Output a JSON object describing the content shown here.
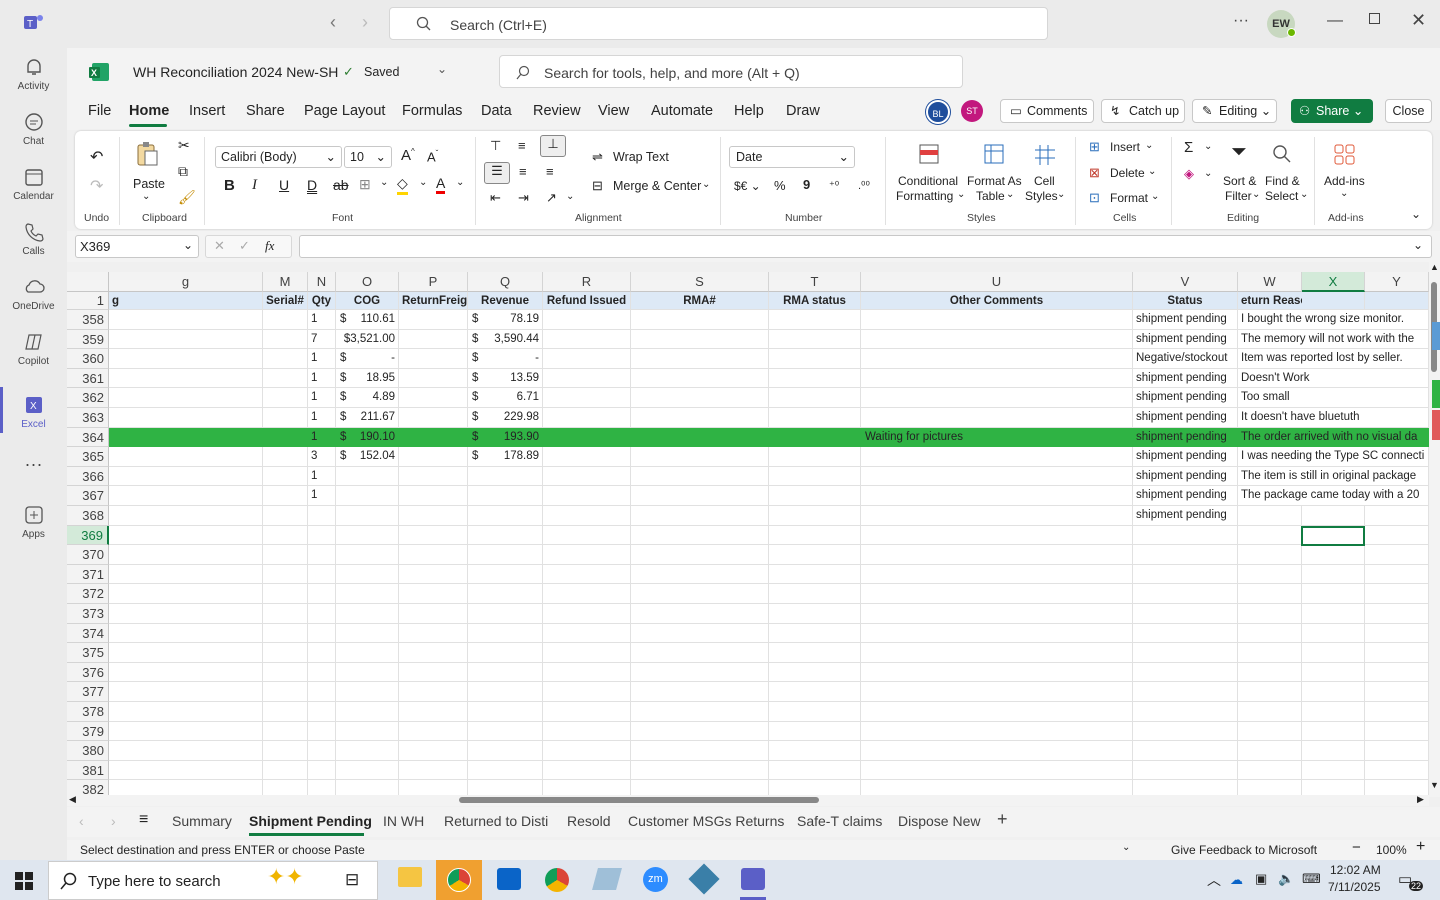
{
  "teams": {
    "search_placeholder": "Search (Ctrl+E)",
    "avatar": "EW"
  },
  "rail": [
    {
      "label": "Activity"
    },
    {
      "label": "Chat"
    },
    {
      "label": "Calendar"
    },
    {
      "label": "Calls"
    },
    {
      "label": "OneDrive"
    },
    {
      "label": "Copilot"
    },
    {
      "label": "Excel"
    },
    {
      "label": "Apps"
    }
  ],
  "workbook": {
    "title": "WH Reconciliation 2024 New-SH",
    "saved": "Saved",
    "search": "Search for tools, help, and more (Alt + Q)"
  },
  "menu": [
    "File",
    "Home",
    "Insert",
    "Share",
    "Page Layout",
    "Formulas",
    "Data",
    "Review",
    "View",
    "Automate",
    "Help",
    "Draw"
  ],
  "header_buttons": {
    "comments": "Comments",
    "catchup": "Catch up",
    "editing": "Editing",
    "share": "Share",
    "close": "Close",
    "av1": "BL",
    "av2": "ST"
  },
  "ribbon": {
    "undo": "Undo",
    "clipboard": "Clipboard",
    "paste": "Paste",
    "font_name": "Calibri (Body)",
    "font_size": "10",
    "font": "Font",
    "wrap": "Wrap Text",
    "merge": "Merge & Center",
    "alignment": "Alignment",
    "numfmt": "Date",
    "number": "Number",
    "cond1": "Conditional",
    "cond2": "Formatting",
    "fat1": "Format As",
    "fat2": "Table",
    "cs1": "Cell",
    "cs2": "Styles",
    "styles": "Styles",
    "insert": "Insert",
    "delete": "Delete",
    "format": "Format",
    "cells": "Cells",
    "sort1": "Sort &",
    "sort2": "Filter",
    "find1": "Find &",
    "find2": "Select",
    "editing": "Editing",
    "addins": "Add-ins",
    "addins_group": "Add-ins"
  },
  "namebox": "X369",
  "columns": [
    {
      "l": "g"
    },
    {
      "l": "M"
    },
    {
      "l": "N"
    },
    {
      "l": "O"
    },
    {
      "l": "P"
    },
    {
      "l": "Q"
    },
    {
      "l": "R"
    },
    {
      "l": "S"
    },
    {
      "l": "T"
    },
    {
      "l": "U"
    },
    {
      "l": "V"
    },
    {
      "l": "W"
    },
    {
      "l": "X"
    },
    {
      "l": "Y"
    }
  ],
  "header_row": {
    "num": "1",
    "cells": [
      "g",
      "Serial#",
      "Qty",
      "COG",
      "ReturnFreight",
      "Revenue",
      "Refund Issued",
      "RMA#",
      "RMA status",
      "Other Comments",
      "Status",
      "eturn Reason",
      "",
      ""
    ]
  },
  "rows": [
    {
      "n": "358",
      "qty": "1",
      "cog": "110.61",
      "rev": "78.19",
      "comment": "",
      "status": "shipment pending",
      "reason": "I bought the wrong size monitor."
    },
    {
      "n": "359",
      "qty": "7",
      "cog": "$3,521.00",
      "rev": "3,590.44",
      "comment": "",
      "status": "shipment pending",
      "reason": "The memory will not work with the"
    },
    {
      "n": "360",
      "qty": "1",
      "cog": "-",
      "rev": "-",
      "comment": "",
      "status": "Negative/stockout",
      "reason": "Item was reported lost by seller."
    },
    {
      "n": "361",
      "qty": "1",
      "cog": "18.95",
      "rev": "13.59",
      "comment": "",
      "status": "shipment pending",
      "reason": "Doesn't Work"
    },
    {
      "n": "362",
      "qty": "1",
      "cog": "4.89",
      "rev": "6.71",
      "comment": "",
      "status": "shipment pending",
      "reason": "Too small"
    },
    {
      "n": "363",
      "qty": "1",
      "cog": "211.67",
      "rev": "229.98",
      "comment": "",
      "status": "shipment pending",
      "reason": "It doesn't have bluetuth"
    },
    {
      "n": "364",
      "qty": "1",
      "cog": "190.10",
      "rev": "193.90",
      "comment": "Waiting for pictures",
      "status": "shipment pending",
      "reason": "The order arrived with no visual da"
    },
    {
      "n": "365",
      "qty": "3",
      "cog": "152.04",
      "rev": "178.89",
      "comment": "",
      "status": "shipment pending",
      "reason": "I was needing the Type SC connecti"
    },
    {
      "n": "366",
      "qty": "1",
      "cog": "",
      "rev": "",
      "comment": "",
      "status": "shipment pending",
      "reason": "The item is still in original package"
    },
    {
      "n": "367",
      "qty": "1",
      "cog": "",
      "rev": "",
      "comment": "",
      "status": "shipment pending",
      "reason": "The package came today with a 20"
    },
    {
      "n": "368",
      "qty": "",
      "cog": "",
      "rev": "",
      "comment": "",
      "status": "shipment pending",
      "reason": ""
    },
    {
      "n": "369"
    },
    {
      "n": "370"
    },
    {
      "n": "371"
    },
    {
      "n": "372"
    },
    {
      "n": "373"
    },
    {
      "n": "374"
    },
    {
      "n": "375"
    },
    {
      "n": "376"
    },
    {
      "n": "377"
    },
    {
      "n": "378"
    },
    {
      "n": "379"
    },
    {
      "n": "380"
    },
    {
      "n": "381"
    },
    {
      "n": "382"
    }
  ],
  "sheets": [
    "Summary",
    "Shipment Pending",
    "IN WH",
    "Returned to Disti",
    "Resold",
    "Customer MSGs Returns",
    "Safe-T claims",
    "Dispose New"
  ],
  "status": {
    "left": "Select destination and press ENTER or choose Paste",
    "feedback": "Give Feedback to Microsoft",
    "zoom": "100%"
  },
  "taskbar": {
    "search": "Type here to search",
    "time": "12:02 AM",
    "date": "7/11/2025",
    "notif": "22"
  },
  "colors": {
    "green_row": "#2fb344",
    "share_btn": "#107c41",
    "header_fill": "#dde9f6"
  }
}
